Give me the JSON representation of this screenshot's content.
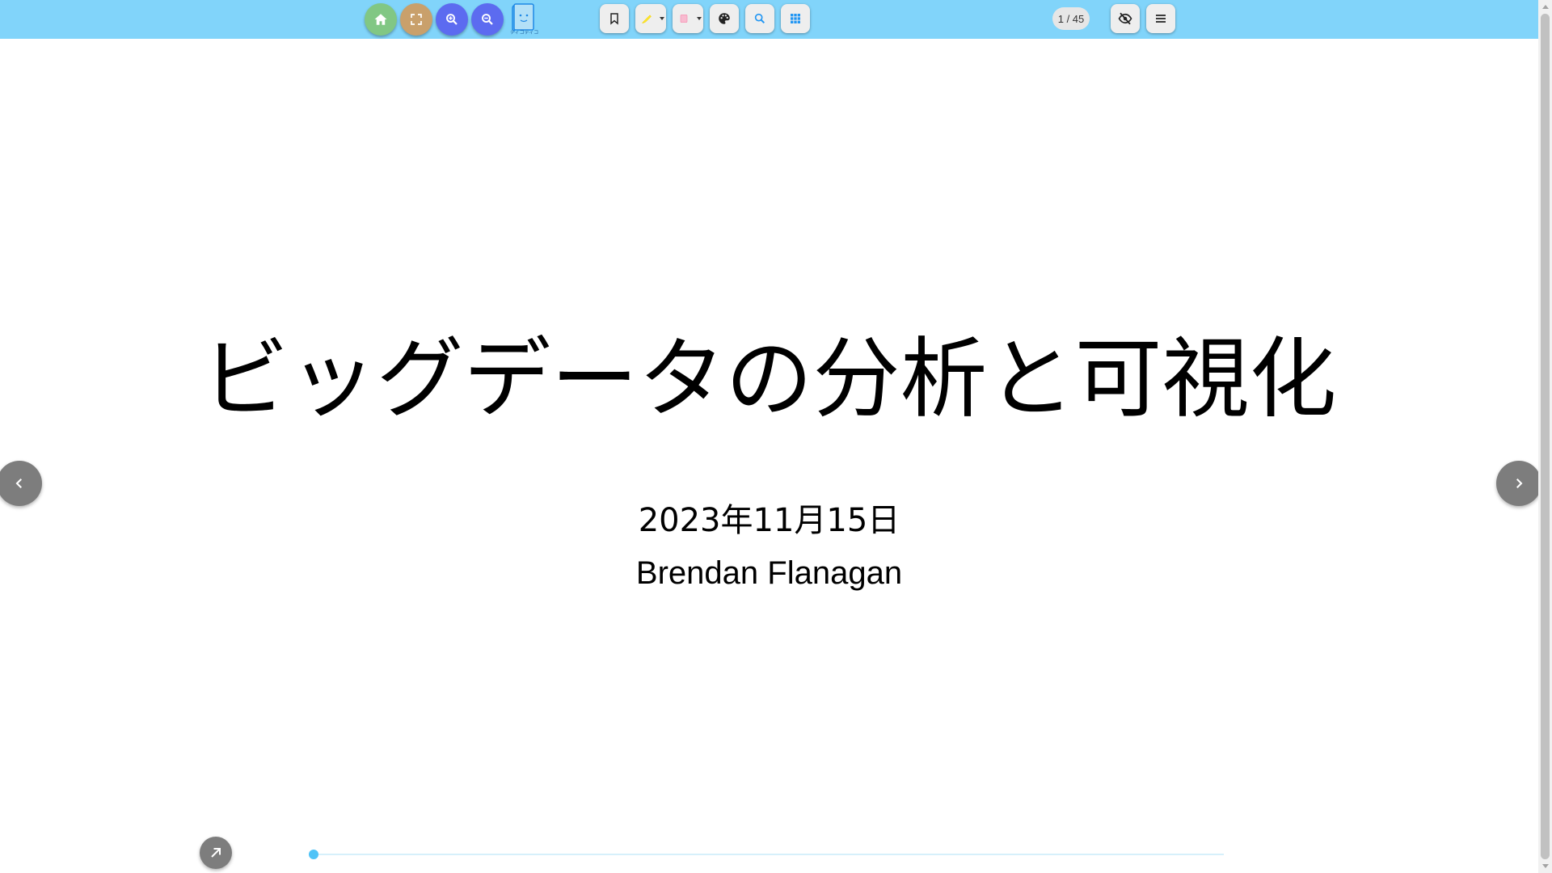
{
  "toolbar": {
    "color": "#81d4fa",
    "left_buttons": [
      {
        "name": "home",
        "icon": "home-icon",
        "color": "#81c784"
      },
      {
        "name": "fullscreen",
        "icon": "fullscreen-icon",
        "color": "#c9a06b"
      },
      {
        "name": "zoom-in",
        "icon": "zoom-in-icon",
        "color": "#5c6bf0"
      },
      {
        "name": "zoom-out",
        "icon": "zoom-out-icon",
        "color": "#5c6bf0"
      }
    ],
    "logo_caption": "ティコティコ",
    "tools": [
      {
        "name": "bookmark",
        "icon": "bookmark-icon"
      },
      {
        "name": "highlighter",
        "icon": "highlighter-icon",
        "color": "#ffeb3b"
      },
      {
        "name": "eraser",
        "icon": "eraser-icon",
        "color": "#f8bbd0"
      },
      {
        "name": "palette",
        "icon": "palette-icon"
      },
      {
        "name": "search",
        "icon": "search-icon",
        "color": "#2196f3"
      },
      {
        "name": "grid",
        "icon": "grid-icon",
        "color": "#2196f3"
      }
    ],
    "page_counter": "1 / 45",
    "right_buttons": [
      {
        "name": "hide",
        "icon": "eye-off-icon"
      },
      {
        "name": "menu",
        "icon": "menu-icon"
      }
    ]
  },
  "slide": {
    "title": "ビッグデータの分析と可視化",
    "date": "2023年11月15日",
    "author": "Brendan Flanagan"
  },
  "navigation": {
    "prev_icon": "chevron-left-icon",
    "next_icon": "chevron-right-icon",
    "expand_icon": "arrow-up-right-icon"
  },
  "progress": {
    "current_page": 1,
    "total_pages": 45,
    "fraction": 0.0
  }
}
